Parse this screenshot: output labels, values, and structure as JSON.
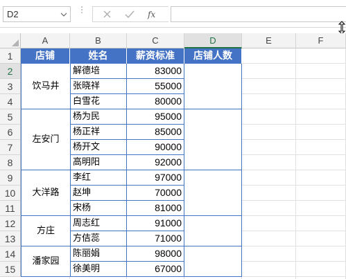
{
  "name_box": {
    "value": "D2"
  },
  "formula": {
    "fx_label": "fx",
    "value": ""
  },
  "columns": [
    "A",
    "B",
    "C",
    "D",
    "E",
    "F"
  ],
  "rows": [
    "1",
    "2",
    "3",
    "4",
    "5",
    "6",
    "7",
    "8",
    "9",
    "10",
    "11",
    "12",
    "13",
    "14",
    "15"
  ],
  "active_cell": "D2",
  "header": {
    "store": "店铺",
    "name": "姓名",
    "salary": "薪资标准",
    "count": "店铺人数"
  },
  "stores": [
    {
      "name": "饮马井",
      "employees": [
        {
          "name": "解德培",
          "salary": "83000"
        },
        {
          "name": "张晓祥",
          "salary": "55000"
        },
        {
          "name": "白雪花",
          "salary": "80000"
        }
      ]
    },
    {
      "name": "左安门",
      "employees": [
        {
          "name": "杨为民",
          "salary": "95000"
        },
        {
          "name": "杨正祥",
          "salary": "85000"
        },
        {
          "name": "杨开文",
          "salary": "90000"
        },
        {
          "name": "高明阳",
          "salary": "92000"
        }
      ]
    },
    {
      "name": "大洋路",
      "employees": [
        {
          "name": "李红",
          "salary": "97000"
        },
        {
          "name": "赵坤",
          "salary": "70000"
        },
        {
          "name": "宋杨",
          "salary": "81000"
        }
      ]
    },
    {
      "name": "方庄",
      "employees": [
        {
          "name": "周志红",
          "salary": "91000"
        },
        {
          "name": "方佶蕊",
          "salary": "71000"
        }
      ]
    },
    {
      "name": "潘家园",
      "employees": [
        {
          "name": "陈丽娟",
          "salary": "98000"
        },
        {
          "name": "徐美明",
          "salary": "67000"
        }
      ]
    }
  ],
  "colors": {
    "header_fill": "#4472c4",
    "header_text": "#ffffff",
    "border": "#4472c4",
    "active_accent": "#217346"
  }
}
